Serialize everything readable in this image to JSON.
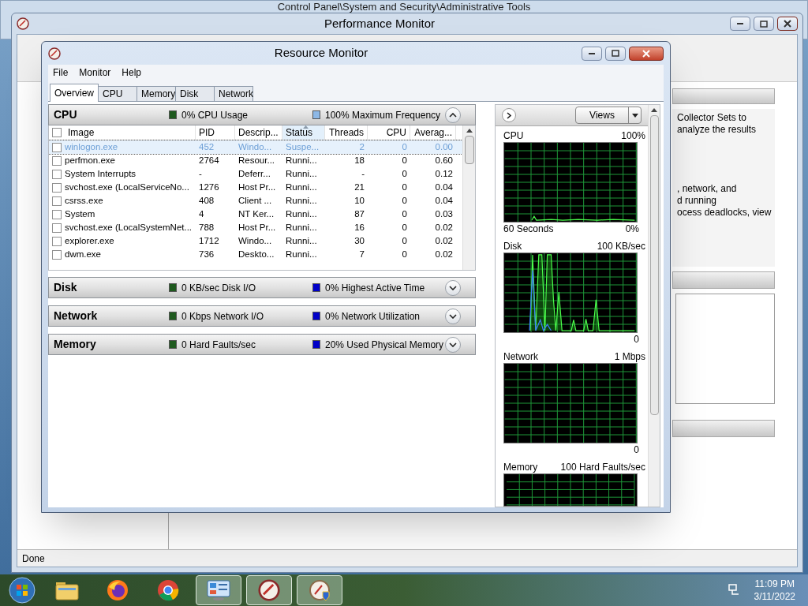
{
  "explorer_window": {
    "title": "Control Panel\\System and Security\\Administrative Tools"
  },
  "perfmon": {
    "title": "Performance Monitor",
    "overview_lines": [
      "Collector Sets to",
      "analyze the results"
    ],
    "resmon_lines": [
      ", network, and",
      "d running",
      "ocess deadlocks, view"
    ],
    "status": "Done"
  },
  "resmon": {
    "title": "Resource Monitor",
    "menu": [
      "File",
      "Monitor",
      "Help"
    ],
    "tabs": [
      {
        "label": "Overview",
        "selected": true
      },
      {
        "label": "CPU",
        "selected": false
      },
      {
        "label": "Memory",
        "selected": false
      },
      {
        "label": "Disk",
        "selected": false
      },
      {
        "label": "Network",
        "selected": false
      }
    ],
    "cpu": {
      "title": "CPU",
      "expanded": true,
      "stats": [
        {
          "text": "0% CPU Usage",
          "color": "#1f5a1f"
        },
        {
          "text": "100% Maximum Frequency",
          "color": "#8db8e6"
        }
      ],
      "columns": [
        {
          "label": "Image",
          "sorted": false
        },
        {
          "label": "PID",
          "sorted": false
        },
        {
          "label": "Descrip...",
          "sorted": false
        },
        {
          "label": "Status",
          "sorted": true
        },
        {
          "label": "Threads",
          "sorted": false
        },
        {
          "label": "CPU",
          "sorted": false
        },
        {
          "label": "Averag...",
          "sorted": false
        }
      ],
      "rows": [
        {
          "selected": true,
          "checked": false,
          "cells": [
            "winlogon.exe",
            "452",
            "Windo...",
            "Suspe...",
            "2",
            "0",
            "0.00"
          ]
        },
        {
          "selected": false,
          "checked": false,
          "cells": [
            "perfmon.exe",
            "2764",
            "Resour...",
            "Runni...",
            "18",
            "0",
            "0.60"
          ]
        },
        {
          "selected": false,
          "checked": false,
          "cells": [
            "System Interrupts",
            "-",
            "Deferr...",
            "Runni...",
            "-",
            "0",
            "0.12"
          ]
        },
        {
          "selected": false,
          "checked": false,
          "cells": [
            "svchost.exe (LocalServiceNo...",
            "1276",
            "Host Pr...",
            "Runni...",
            "21",
            "0",
            "0.04"
          ]
        },
        {
          "selected": false,
          "checked": false,
          "cells": [
            "csrss.exe",
            "408",
            "Client ...",
            "Runni...",
            "10",
            "0",
            "0.04"
          ]
        },
        {
          "selected": false,
          "checked": false,
          "cells": [
            "System",
            "4",
            "NT Ker...",
            "Runni...",
            "87",
            "0",
            "0.03"
          ]
        },
        {
          "selected": false,
          "checked": false,
          "cells": [
            "svchost.exe (LocalSystemNet...",
            "788",
            "Host Pr...",
            "Runni...",
            "16",
            "0",
            "0.02"
          ]
        },
        {
          "selected": false,
          "checked": false,
          "cells": [
            "explorer.exe",
            "1712",
            "Windo...",
            "Runni...",
            "30",
            "0",
            "0.02"
          ]
        },
        {
          "selected": false,
          "checked": false,
          "cells": [
            "dwm.exe",
            "736",
            "Deskto...",
            "Runni...",
            "7",
            "0",
            "0.02"
          ]
        }
      ]
    },
    "sections": [
      {
        "title": "Disk",
        "expanded": false,
        "stats": [
          {
            "text": "0 KB/sec Disk I/O",
            "color": "#1f5a1f"
          },
          {
            "text": "0% Highest Active Time",
            "color": "#0000c8"
          }
        ]
      },
      {
        "title": "Network",
        "expanded": false,
        "stats": [
          {
            "text": "0 Kbps Network I/O",
            "color": "#1f5a1f"
          },
          {
            "text": "0% Network Utilization",
            "color": "#0000c8"
          }
        ]
      },
      {
        "title": "Memory",
        "expanded": false,
        "stats": [
          {
            "text": "0 Hard Faults/sec",
            "color": "#1f5a1f"
          },
          {
            "text": "20% Used Physical Memory",
            "color": "#0000c8"
          }
        ]
      }
    ],
    "side": {
      "views": "Views",
      "graphs": [
        {
          "kind": "flat",
          "title": "CPU",
          "max": "100%",
          "time": "60 Seconds",
          "min": "0%"
        },
        {
          "kind": "spikes",
          "title": "Disk",
          "max": "100 KB/sec",
          "min": "0"
        },
        {
          "kind": "empty",
          "title": "Network",
          "max": "1 Mbps",
          "min": "0"
        },
        {
          "kind": "cut",
          "title": "Memory",
          "max": "100 Hard Faults/sec"
        }
      ]
    }
  },
  "taskbar": {
    "apps": [
      {
        "kind": "folder",
        "running": false
      },
      {
        "kind": "firefox",
        "running": false
      },
      {
        "kind": "chrome",
        "running": false
      },
      {
        "kind": "control-panel",
        "running": true
      },
      {
        "kind": "perfmon",
        "running": true
      },
      {
        "kind": "resmon",
        "running": true
      }
    ],
    "time": "11:09 PM",
    "date": "3/11/2022"
  }
}
